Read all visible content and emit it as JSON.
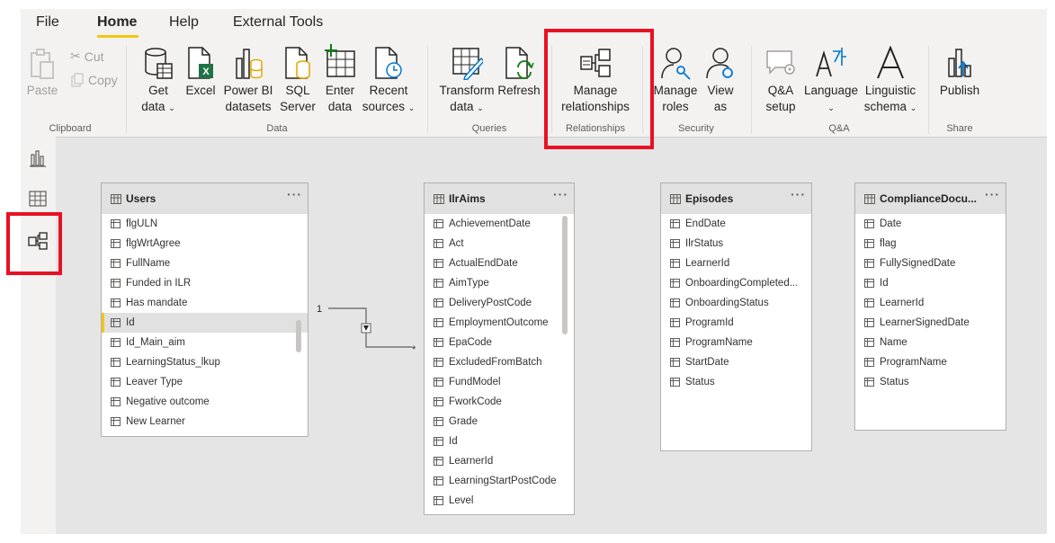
{
  "menu": {
    "tabs": [
      {
        "label": "File"
      },
      {
        "label": "Home"
      },
      {
        "label": "Help"
      },
      {
        "label": "External Tools"
      }
    ]
  },
  "ribbon": {
    "clipboard": {
      "paste": "Paste",
      "cut": "Cut",
      "copy": "Copy",
      "label": "Clipboard"
    },
    "data": {
      "get_data": [
        "Get",
        "data"
      ],
      "excel": "Excel",
      "power_bi": [
        "Power BI",
        "datasets"
      ],
      "sql": [
        "SQL",
        "Server"
      ],
      "enter": [
        "Enter",
        "data"
      ],
      "recent": [
        "Recent",
        "sources"
      ],
      "label": "Data"
    },
    "queries": {
      "transform": [
        "Transform",
        "data"
      ],
      "refresh": "Refresh",
      "label": "Queries"
    },
    "relationships": {
      "manage": [
        "Manage",
        "relationships"
      ],
      "label": "Relationships"
    },
    "security": {
      "roles": [
        "Manage",
        "roles"
      ],
      "view": [
        "View",
        "as"
      ],
      "label": "Security"
    },
    "qa": {
      "setup": [
        "Q&A",
        "setup"
      ],
      "language": "Language",
      "linguistic": [
        "Linguistic",
        "schema"
      ],
      "label": "Q&A"
    },
    "share": {
      "publish": "Publish",
      "label": "Share"
    }
  },
  "tables": [
    {
      "name": "Users",
      "fields": [
        "flgULN",
        "flgWrtAgree",
        "FullName",
        "Funded in ILR",
        "Has mandate",
        "Id",
        "Id_Main_aim",
        "LearningStatus_lkup",
        "Leaver Type",
        "Negative outcome",
        "New Learner"
      ]
    },
    {
      "name": "IlrAims",
      "fields": [
        "AchievementDate",
        "Act",
        "ActualEndDate",
        "AimType",
        "DeliveryPostCode",
        "EmploymentOutcome",
        "EpaCode",
        "ExcludedFromBatch",
        "FundModel",
        "FworkCode",
        "Grade",
        "Id",
        "LearnerId",
        "LearningStartPostCode",
        "Level"
      ]
    },
    {
      "name": "Episodes",
      "fields": [
        "EndDate",
        "IlrStatus",
        "LearnerId",
        "OnboardingCompleted...",
        "OnboardingStatus",
        "ProgramId",
        "ProgramName",
        "StartDate",
        "Status"
      ]
    },
    {
      "name": "ComplianceDocu...",
      "fields": [
        "Date",
        "flag",
        "FullySignedDate",
        "Id",
        "LearnerId",
        "LearnerSignedDate",
        "Name",
        "ProgramName",
        "Status"
      ]
    }
  ],
  "relationship": {
    "from_cardinality": "1",
    "to_cardinality": "*"
  },
  "colors": {
    "accent": "#f2c811",
    "highlight": "#e81123"
  }
}
